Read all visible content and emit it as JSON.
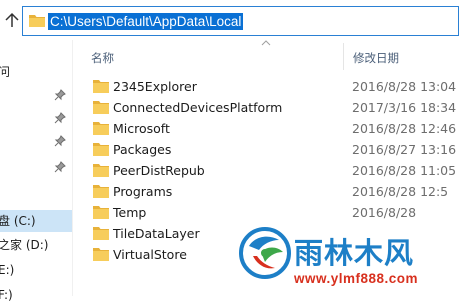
{
  "address_bar": {
    "path": "C:\\Users\\Default\\AppData\\Local"
  },
  "sidebar": {
    "items": [
      {
        "label": "问",
        "pinned": false,
        "selected": false
      },
      {
        "label": "",
        "pinned": true,
        "selected": false
      },
      {
        "label": "",
        "pinned": true,
        "selected": false
      },
      {
        "label": "",
        "pinned": true,
        "selected": false
      },
      {
        "label": "",
        "pinned": true,
        "selected": false
      },
      {
        "label": "盘 (C:)",
        "pinned": false,
        "selected": true
      },
      {
        "label": "之家 (D:)",
        "pinned": false,
        "selected": false
      },
      {
        "label": "E:)",
        "pinned": false,
        "selected": false
      },
      {
        "label": "F:)",
        "pinned": false,
        "selected": false
      }
    ]
  },
  "columns": {
    "name": "名称",
    "date": "修改日期"
  },
  "files": [
    {
      "name": "2345Explorer",
      "date": "2016/8/28 13:04"
    },
    {
      "name": "ConnectedDevicesPlatform",
      "date": "2017/3/16 18:34"
    },
    {
      "name": "Microsoft",
      "date": "2016/8/28 12:46"
    },
    {
      "name": "Packages",
      "date": "2016/8/27 13:16"
    },
    {
      "name": "PeerDistRepub",
      "date": "2016/8/28 11:05"
    },
    {
      "name": "Programs",
      "date": "2016/8/28 12:5"
    },
    {
      "name": "Temp",
      "date": "2016/8/28"
    },
    {
      "name": "TileDataLayer",
      "date": ""
    },
    {
      "name": "VirtualStore",
      "date": ""
    }
  ],
  "watermark": {
    "title": "雨林木风",
    "url": "www.ylmf888.com"
  },
  "colors": {
    "selection": "#0a70d4",
    "folder": "#f5c34c",
    "watermark_blue": "#1d7fc7",
    "watermark_red": "#d8301e"
  }
}
